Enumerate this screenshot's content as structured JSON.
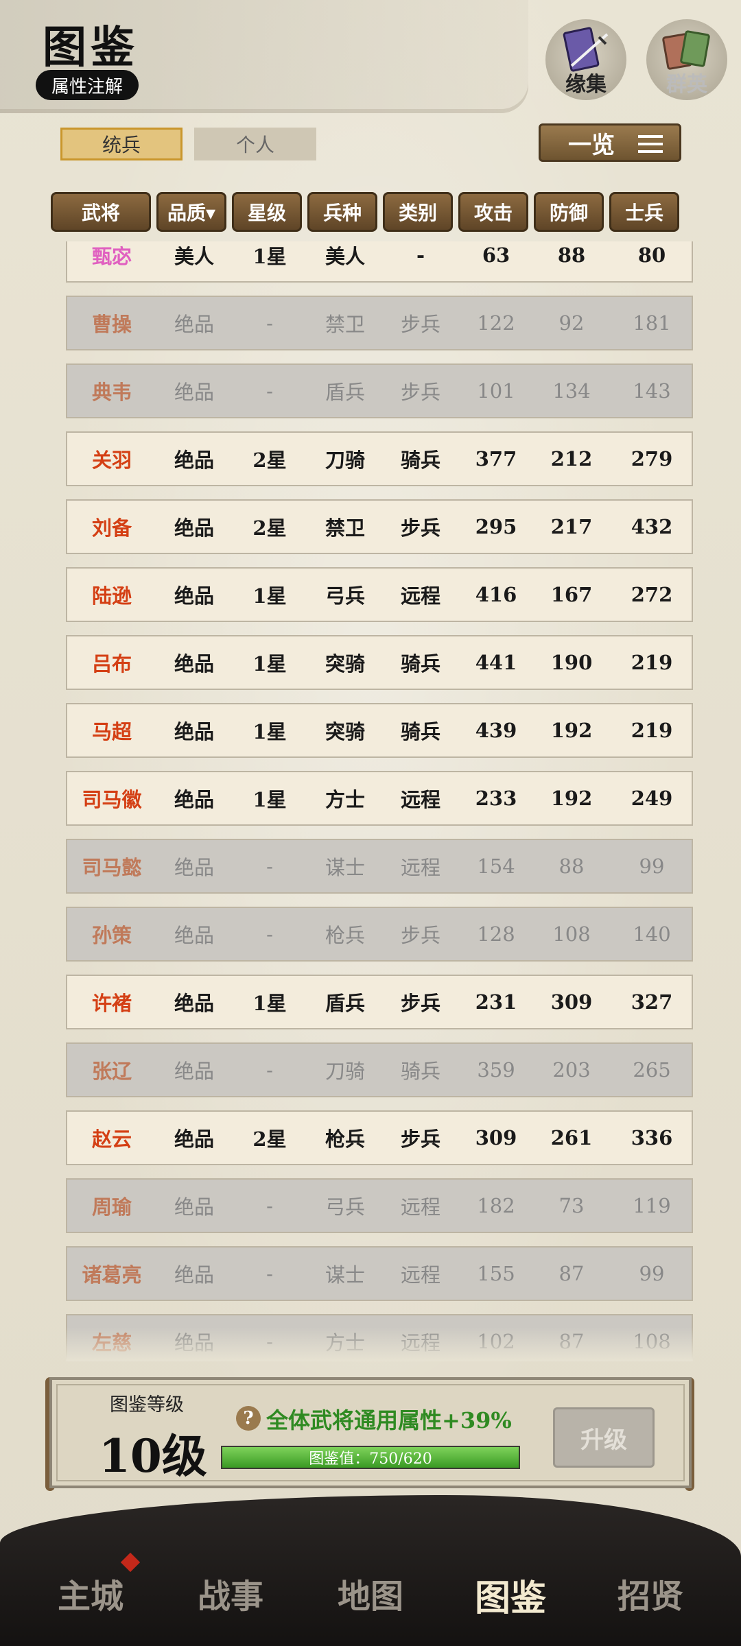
{
  "header": {
    "title": "图鉴",
    "attribute_button": "属性注解",
    "icons": [
      {
        "name": "缘集",
        "icon": "book-sword-icon"
      },
      {
        "name": "群英",
        "icon": "heroes-card-icon"
      }
    ]
  },
  "tabs": [
    "统兵",
    "个人"
  ],
  "overview_button": "一览",
  "columns": [
    "武将",
    "品质▾",
    "星级",
    "兵种",
    "类别",
    "攻击",
    "防御",
    "士兵"
  ],
  "rows": [
    {
      "name": "甄宓",
      "quality": "美人",
      "star": "1星",
      "troop": "美人",
      "type": "-",
      "atk": "63",
      "def": "88",
      "soldiers": "80",
      "owned": true,
      "pink": true
    },
    {
      "name": "曹操",
      "quality": "绝品",
      "star": "-",
      "troop": "禁卫",
      "type": "步兵",
      "atk": "122",
      "def": "92",
      "soldiers": "181",
      "owned": false
    },
    {
      "name": "典韦",
      "quality": "绝品",
      "star": "-",
      "troop": "盾兵",
      "type": "步兵",
      "atk": "101",
      "def": "134",
      "soldiers": "143",
      "owned": false
    },
    {
      "name": "关羽",
      "quality": "绝品",
      "star": "2星",
      "troop": "刀骑",
      "type": "骑兵",
      "atk": "377",
      "def": "212",
      "soldiers": "279",
      "owned": true
    },
    {
      "name": "刘备",
      "quality": "绝品",
      "star": "2星",
      "troop": "禁卫",
      "type": "步兵",
      "atk": "295",
      "def": "217",
      "soldiers": "432",
      "owned": true
    },
    {
      "name": "陆逊",
      "quality": "绝品",
      "star": "1星",
      "troop": "弓兵",
      "type": "远程",
      "atk": "416",
      "def": "167",
      "soldiers": "272",
      "owned": true
    },
    {
      "name": "吕布",
      "quality": "绝品",
      "star": "1星",
      "troop": "突骑",
      "type": "骑兵",
      "atk": "441",
      "def": "190",
      "soldiers": "219",
      "owned": true
    },
    {
      "name": "马超",
      "quality": "绝品",
      "star": "1星",
      "troop": "突骑",
      "type": "骑兵",
      "atk": "439",
      "def": "192",
      "soldiers": "219",
      "owned": true
    },
    {
      "name": "司马徽",
      "quality": "绝品",
      "star": "1星",
      "troop": "方士",
      "type": "远程",
      "atk": "233",
      "def": "192",
      "soldiers": "249",
      "owned": true
    },
    {
      "name": "司马懿",
      "quality": "绝品",
      "star": "-",
      "troop": "谋士",
      "type": "远程",
      "atk": "154",
      "def": "88",
      "soldiers": "99",
      "owned": false
    },
    {
      "name": "孙策",
      "quality": "绝品",
      "star": "-",
      "troop": "枪兵",
      "type": "步兵",
      "atk": "128",
      "def": "108",
      "soldiers": "140",
      "owned": false
    },
    {
      "name": "许褚",
      "quality": "绝品",
      "star": "1星",
      "troop": "盾兵",
      "type": "步兵",
      "atk": "231",
      "def": "309",
      "soldiers": "327",
      "owned": true
    },
    {
      "name": "张辽",
      "quality": "绝品",
      "star": "-",
      "troop": "刀骑",
      "type": "骑兵",
      "atk": "359",
      "def": "203",
      "soldiers": "265",
      "owned": false
    },
    {
      "name": "赵云",
      "quality": "绝品",
      "star": "2星",
      "troop": "枪兵",
      "type": "步兵",
      "atk": "309",
      "def": "261",
      "soldiers": "336",
      "owned": true
    },
    {
      "name": "周瑜",
      "quality": "绝品",
      "star": "-",
      "troop": "弓兵",
      "type": "远程",
      "atk": "182",
      "def": "73",
      "soldiers": "119",
      "owned": false
    },
    {
      "name": "诸葛亮",
      "quality": "绝品",
      "star": "-",
      "troop": "谋士",
      "type": "远程",
      "atk": "155",
      "def": "87",
      "soldiers": "99",
      "owned": false
    },
    {
      "name": "左慈",
      "quality": "绝品",
      "star": "-",
      "troop": "方士",
      "type": "远程",
      "atk": "102",
      "def": "87",
      "soldiers": "108",
      "owned": false
    }
  ],
  "level_panel": {
    "label": "图鉴等级",
    "level": "10级",
    "bonus": "全体武将通用属性+39%",
    "progress_text": "图鉴值：750/620",
    "progress": 1.0,
    "upgrade_button": "升级"
  },
  "nav": {
    "items": [
      "主城",
      "战事",
      "地图",
      "图鉴",
      "招贤"
    ],
    "active": "图鉴"
  },
  "colors": {
    "owned_name": "#d43f14",
    "unowned_name": "#c07a5a",
    "beauty_name": "#e060c0",
    "bonus_text": "#2f8a22",
    "header_brown": "#6e5430"
  }
}
